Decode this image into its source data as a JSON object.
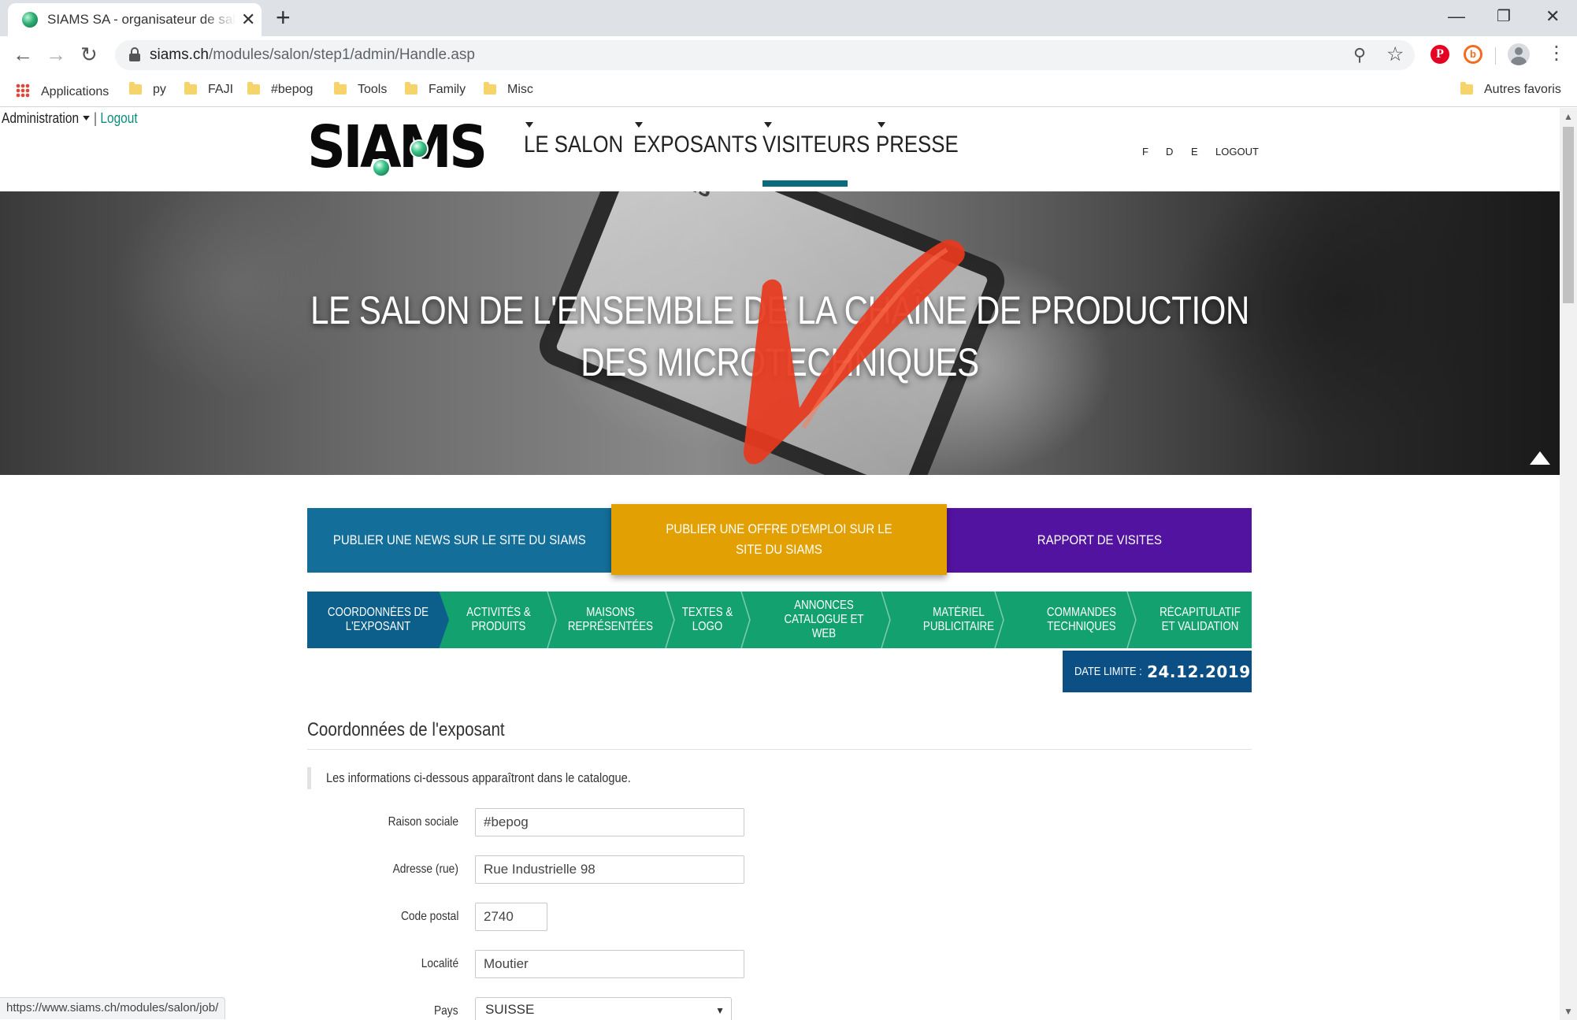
{
  "browser": {
    "tab_title": "SIAMS SA - organisateur de salons",
    "url_host": "siams.ch",
    "url_path": "/modules/salon/step1/admin/Handle.asp",
    "status_url": "https://www.siams.ch/modules/salon/job/"
  },
  "bookmarks": {
    "apps": "Applications",
    "items": [
      "py",
      "FAJI",
      "#bepog",
      "Tools",
      "Family",
      "Misc"
    ],
    "other": "Autres favoris"
  },
  "admin": {
    "menu": "Administration",
    "separator": "|",
    "logout": "Logout"
  },
  "header": {
    "logo": "SIAMS",
    "nav": [
      "LE SALON",
      "EXPOSANTS",
      "VISITEURS",
      "PRESSE"
    ],
    "active_nav": "VISITEURS",
    "languages": [
      "F",
      "D",
      "E"
    ],
    "logout": "LOGOUT"
  },
  "hero": {
    "title_line1": "LE SALON DE L'ENSEMBLE DE LA CHAÎNE DE PRODUCTION",
    "title_line2": "DES MICROTECHNIQUES",
    "tablet_label": "SIAMS"
  },
  "actions": {
    "news": "PUBLIER UNE NEWS SUR LE SITE DU SIAMS",
    "job": "PUBLIER UNE OFFRE D'EMPLOI SUR LE SITE DU SIAMS",
    "visits": "RAPPORT DE VISITES"
  },
  "steps": [
    "COORDONNÉES DE L'EXPOSANT",
    "ACTIVITÉS & PRODUITS",
    "MAISONS REPRÉSENTÉES",
    "TEXTES & LOGO",
    "ANNONCES CATALOGUE ET WEB",
    "MATÉRIEL PUBLICITAIRE",
    "COMMANDES TECHNIQUES",
    "RÉCAPITULATIF ET VALIDATION"
  ],
  "deadline": {
    "label": "DATE LIMITE :",
    "value": "24.12.2019"
  },
  "form": {
    "section_title": "Coordonnées de l'exposant",
    "note": "Les informations ci-dessous apparaîtront dans le catalogue.",
    "company_label": "Raison sociale",
    "company_value": "#bepog",
    "street_label": "Adresse (rue)",
    "street_value": "Rue Industrielle 98",
    "zip_label": "Code postal",
    "zip_value": "2740",
    "city_label": "Localité",
    "city_value": "Moutier",
    "country_label": "Pays",
    "country_value": "SUISSE"
  },
  "colors": {
    "news": "#136e99",
    "job": "#e2a003",
    "visits": "#5213a0",
    "step_active": "#0b5f8a",
    "step": "#13a26f",
    "deadline": "#0b4f84",
    "arrow": "#e8391f"
  }
}
